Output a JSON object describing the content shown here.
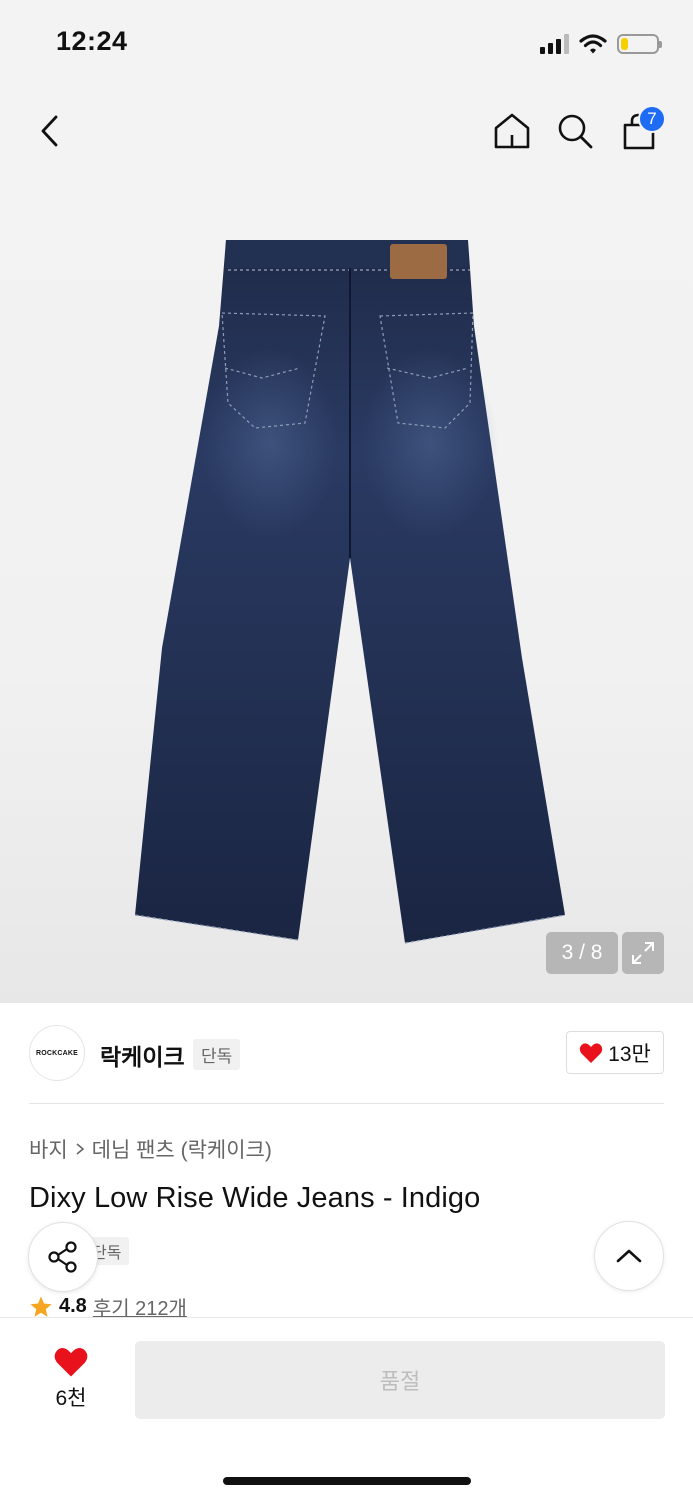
{
  "status_bar": {
    "time": "12:24",
    "battery_level": 0.2,
    "battery_color": "#f5d000"
  },
  "nav": {
    "back_icon": "chevron-left-icon",
    "home_icon": "home-icon",
    "search_icon": "search-icon",
    "cart_icon": "shopping-bag-icon",
    "cart_count": "7",
    "badge_color": "#1e6cf3"
  },
  "gallery": {
    "counter": "3 / 8",
    "current": 3,
    "total": 8,
    "expand_icon": "expand-icon",
    "label_text": "ROCKCAKE"
  },
  "brand": {
    "logo_text": "ROCKCAKE",
    "name": "락케이크",
    "tag": "단독",
    "like_count": "13만",
    "heart_color": "#e8111c"
  },
  "product": {
    "breadcrumb": [
      "바지",
      "데님 팬츠 (락케이크)"
    ],
    "title": "Dixy Low Rise Wide Jeans - Indigo",
    "exclusive_tag": "단독",
    "rating": "4.8",
    "reviews": "후기 212개",
    "star_color": "#f5a623"
  },
  "floating": {
    "share_icon": "share-icon",
    "scroll_top_icon": "chevron-up-icon"
  },
  "bottom": {
    "wish_count": "6천",
    "soldout_label": "품절"
  }
}
